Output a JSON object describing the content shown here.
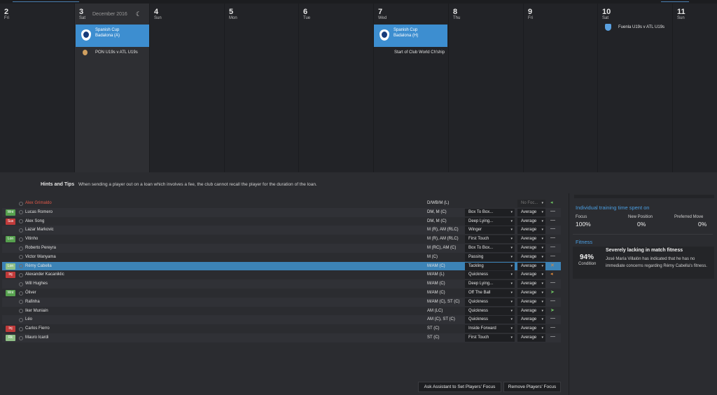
{
  "calendar": {
    "month_label": "December 2016",
    "days": [
      {
        "num": "2",
        "wd": "Fri"
      },
      {
        "num": "3",
        "wd": "Sat"
      },
      {
        "num": "4",
        "wd": "Sun"
      },
      {
        "num": "5",
        "wd": "Mon"
      },
      {
        "num": "6",
        "wd": "Tue"
      },
      {
        "num": "7",
        "wd": "Wed"
      },
      {
        "num": "8",
        "wd": "Thu"
      },
      {
        "num": "9",
        "wd": "Fri"
      },
      {
        "num": "10",
        "wd": "Sat"
      },
      {
        "num": "11",
        "wd": "Sun"
      }
    ],
    "events": {
      "sat3_cup_title": "Spanish Cup",
      "sat3_cup_opp": "Badalona (A)",
      "sat3_youth": "PON U19s v ATL U19s",
      "wed7_cup_title": "Spanish Cup",
      "wed7_cup_opp": "Badalona (H)",
      "wed7_note": "Start of Club World Ch'ship",
      "sat10_youth": "Fuenla U19s v ATL U19s"
    },
    "accent": "#3d8ed0"
  },
  "hints": {
    "title": "Hints and Tips",
    "text": "When sending a player out on a loan which involves a fee, the club cannot recall the player for the duration of the loan."
  },
  "players": [
    {
      "tag": "",
      "name": "Alex Grimaldo",
      "pos": "D/WB/M (L)",
      "focus": "",
      "intensity": "No Foc..."
    },
    {
      "tag": "Wnt",
      "name": "Lucas Romero",
      "pos": "DM, M (C)",
      "focus": "Box To Box...",
      "intensity": "Average"
    },
    {
      "tag": "Sus",
      "name": "Alex Song",
      "pos": "DM, M (C)",
      "focus": "Deep Lying...",
      "intensity": "Average"
    },
    {
      "tag": "",
      "name": "Lazar Markovic",
      "pos": "M (R), AM (RLC)",
      "focus": "Winger",
      "intensity": "Average"
    },
    {
      "tag": "Lon",
      "name": "Vitinho",
      "pos": "M (R), AM (RLC)",
      "focus": "First Touch",
      "intensity": "Average"
    },
    {
      "tag": "",
      "name": "Roberto Pereyra",
      "pos": "M (RC), AM (C)",
      "focus": "Box To Box...",
      "intensity": "Average"
    },
    {
      "tag": "",
      "name": "Victor Wanyama",
      "pos": "M (C)",
      "focus": "Passing",
      "intensity": "Average"
    },
    {
      "tag": "Lon",
      "name": "Rémy Cabella",
      "pos": "M/AM (C)",
      "focus": "Tackling",
      "intensity": "Average"
    },
    {
      "tag": "Inj",
      "name": "Alexander Kacaniklic",
      "pos": "M/AM (L)",
      "focus": "Quickness",
      "intensity": "Average"
    },
    {
      "tag": "",
      "name": "Will Hughes",
      "pos": "M/AM (C)",
      "focus": "Deep Lying...",
      "intensity": "Average"
    },
    {
      "tag": "Wnt",
      "name": "Óliver",
      "pos": "M/AM (C)",
      "focus": "Off The Ball",
      "intensity": "Average"
    },
    {
      "tag": "",
      "name": "Rafinha",
      "pos": "M/AM (C), ST (C)",
      "focus": "Quickness",
      "intensity": "Average"
    },
    {
      "tag": "",
      "name": "Iker Muniain",
      "pos": "AM (LC)",
      "focus": "Quickness",
      "intensity": "Average"
    },
    {
      "tag": "",
      "name": "Léo",
      "pos": "AM (C), ST (C)",
      "focus": "Quickness",
      "intensity": "Average"
    },
    {
      "tag": "Inj",
      "name": "Carlos Fierro",
      "pos": "ST (C)",
      "focus": "Inside Forward",
      "intensity": "Average"
    },
    {
      "tag": "Rk",
      "name": "Mauro Icardi",
      "pos": "ST (C)",
      "focus": "First Touch",
      "intensity": "Average"
    }
  ],
  "buttons": {
    "ask": "Ask Assistant to Set Players' Focus",
    "remove": "Remove Players' Focus"
  },
  "training": {
    "title": "Individual training time spent on",
    "focus_label": "Focus",
    "focus_value": "100%",
    "newpos_label": "New Position",
    "newpos_value": "0%",
    "prefmove_label": "Preferred Move",
    "prefmove_value": "0%"
  },
  "fitness": {
    "title": "Fitness",
    "percent": "94%",
    "condition_label": "Condition",
    "headline": "Severely lacking in match fitness",
    "body": "José María Villalón has indicated that he has no immediate concerns regarding Rémy Cabella's fitness."
  }
}
